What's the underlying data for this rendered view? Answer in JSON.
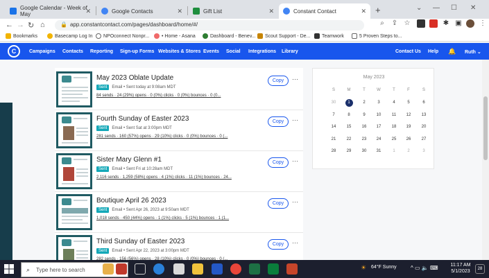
{
  "browser": {
    "tabs": [
      {
        "title": "Google Calendar - Week of May",
        "color": "#1a73e8"
      },
      {
        "title": "Google Contacts",
        "color": "#4285f4"
      },
      {
        "title": "Gift List",
        "color": "#1e8e3e"
      },
      {
        "title": "Constant Contact",
        "color": "#4285f4"
      }
    ],
    "url": "app.constantcontact.com/pages/dashboard/home/#/",
    "bookmarks": [
      "Bookmarks",
      "Basecamp Log In",
      "NPOconnect Nonpr...",
      "• Home - Asana",
      "Dashboard - Benev...",
      "Scout Support - De...",
      "Teamwork",
      "5 Proven Steps to..."
    ]
  },
  "nav": {
    "items": [
      "Campaigns",
      "Contacts",
      "Reporting",
      "Sign-up Forms",
      "Websites & Stores",
      "Events",
      "Social",
      "Integrations",
      "Library"
    ],
    "right": [
      "Contact Us",
      "Help",
      "Ruth"
    ]
  },
  "campaigns": [
    {
      "title": "May 2023 Oblate Update",
      "status": "Sent",
      "meta": "Email • Sent today at 9:08am MDT",
      "stats": "84 sends · 24 (29%) opens · 0 (0%) clicks · 0 (0%) bounces · 0 (0..."
    },
    {
      "title": "Fourth Sunday of Easter 2023",
      "status": "Sent",
      "meta": "Email • Sent Sat at 3:00pm MDT",
      "stats": "281 sends · 160 (57%) opens · 29 (10%) clicks · 0 (0%) bounces · 0 (..."
    },
    {
      "title": "Sister Mary Glenn #1",
      "status": "Sent",
      "meta": "Email • Sent Fri at 10:28am MDT",
      "stats": "2,116 sends · 1,259 (58%) opens · 4 (1%) clicks · 11 (1%) bounces · 24..."
    },
    {
      "title": "Boutique April 26 2023",
      "status": "Sent",
      "meta": "Email • Sent Apr 26, 2023 at 9:50am MDT",
      "stats": "1,018 sends · 450 (44%) opens · 1 (1%) clicks · 5 (1%) bounces · 1 (1..."
    },
    {
      "title": "Third Sunday of Easter 2023",
      "status": "Sent",
      "meta": "Email • Sent Apr 22, 2023 at 3:00pm MDT",
      "stats": "282 sends · 156 (56%) opens · 28 (10%) clicks · 0 (0%) bounces · 0 (..."
    }
  ],
  "copy_label": "Copy",
  "more_label": "···",
  "calendar": {
    "month": "May 2023",
    "dow": [
      "S",
      "M",
      "T",
      "W",
      "T",
      "F",
      "S"
    ],
    "weeks": [
      [
        "30",
        "1",
        "2",
        "3",
        "4",
        "5",
        "6"
      ],
      [
        "7",
        "8",
        "9",
        "10",
        "11",
        "12",
        "13"
      ],
      [
        "14",
        "15",
        "16",
        "17",
        "18",
        "19",
        "20"
      ],
      [
        "21",
        "22",
        "23",
        "24",
        "25",
        "26",
        "27"
      ],
      [
        "28",
        "29",
        "30",
        "31",
        "1",
        "2",
        "3"
      ]
    ],
    "today": "1"
  },
  "taskbar": {
    "search_placeholder": "Type here to search",
    "weather": "64°F Sunny",
    "time": "11:17 AM",
    "date": "5/1/2023"
  }
}
